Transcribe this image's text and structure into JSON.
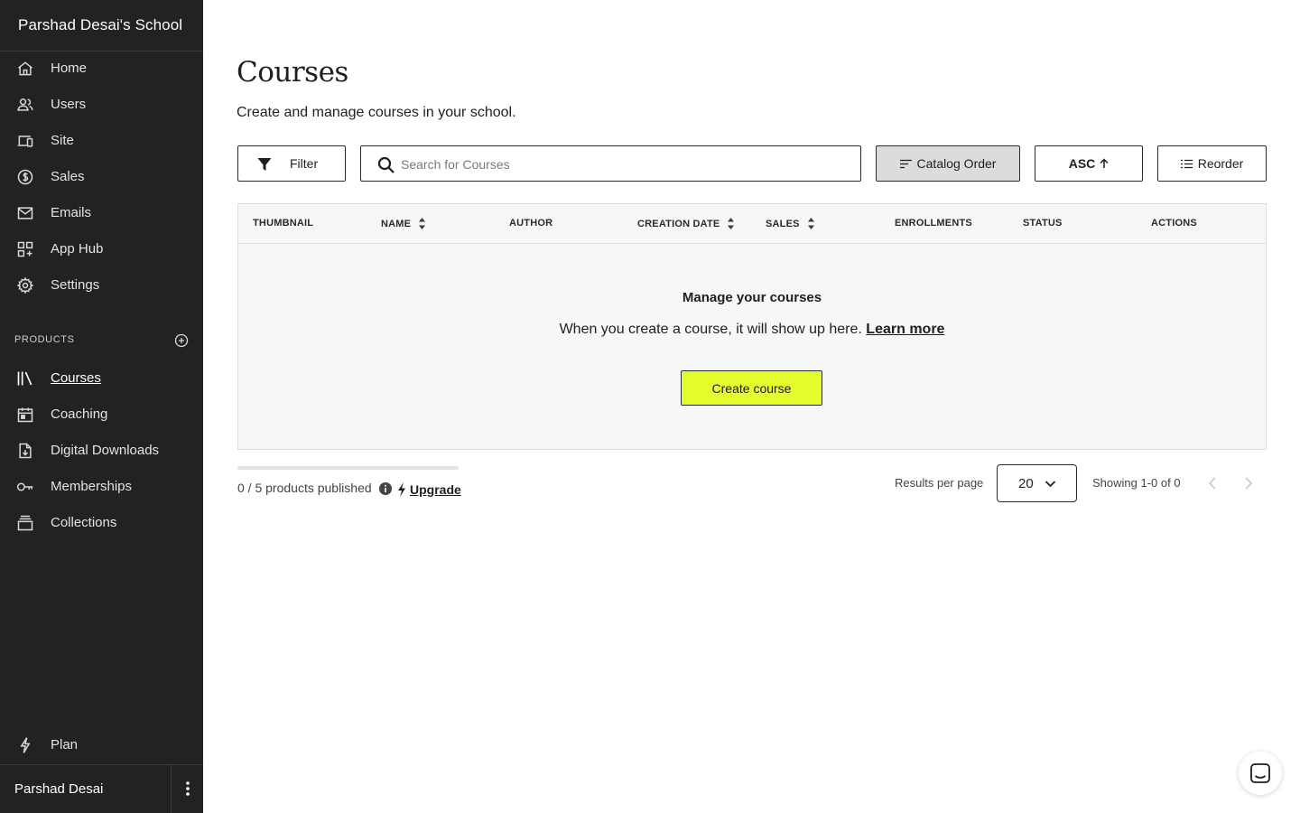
{
  "sidebar": {
    "school_name": "Parshad Desai's School",
    "nav": [
      {
        "label": "Home",
        "icon": "home-icon"
      },
      {
        "label": "Users",
        "icon": "users-icon"
      },
      {
        "label": "Site",
        "icon": "devices-icon"
      },
      {
        "label": "Sales",
        "icon": "dollar-icon"
      },
      {
        "label": "Emails",
        "icon": "mail-icon"
      },
      {
        "label": "App Hub",
        "icon": "apps-icon"
      },
      {
        "label": "Settings",
        "icon": "gear-icon"
      }
    ],
    "products_label": "PRODUCTS",
    "products": [
      {
        "label": "Courses",
        "icon": "library-icon",
        "active": true
      },
      {
        "label": "Coaching",
        "icon": "calendar-icon"
      },
      {
        "label": "Digital Downloads",
        "icon": "download-file-icon"
      },
      {
        "label": "Memberships",
        "icon": "key-icon"
      },
      {
        "label": "Collections",
        "icon": "stack-icon"
      }
    ],
    "plan_label": "Plan",
    "user_name": "Parshad Desai"
  },
  "main": {
    "title": "Courses",
    "subtitle": "Create and manage courses in your school.",
    "toolbar": {
      "filter_label": "Filter",
      "search_placeholder": "Search for Courses",
      "sort_label": "Catalog Order",
      "order_label": "ASC",
      "reorder_label": "Reorder"
    },
    "table": {
      "columns": [
        {
          "label": "THUMBNAIL",
          "sortable": false
        },
        {
          "label": "NAME",
          "sortable": true
        },
        {
          "label": "AUTHOR",
          "sortable": false
        },
        {
          "label": "CREATION DATE",
          "sortable": true
        },
        {
          "label": "SALES",
          "sortable": true
        },
        {
          "label": "ENROLLMENTS",
          "sortable": false
        },
        {
          "label": "STATUS",
          "sortable": false
        },
        {
          "label": "ACTIONS",
          "sortable": false
        }
      ],
      "empty_title": "Manage your courses",
      "empty_text": "When you create a course, it will show up here.",
      "learn_more": "Learn more",
      "create_label": "Create course"
    },
    "footer": {
      "published_text": "0 / 5 products published",
      "published_fraction": 0,
      "upgrade_label": "Upgrade",
      "results_per_page_label": "Results per page",
      "results_per_page_value": "20",
      "showing_text": "Showing 1-0 of 0"
    }
  },
  "colors": {
    "sidebar_bg": "#222222",
    "accent": "#e3fc2c"
  }
}
